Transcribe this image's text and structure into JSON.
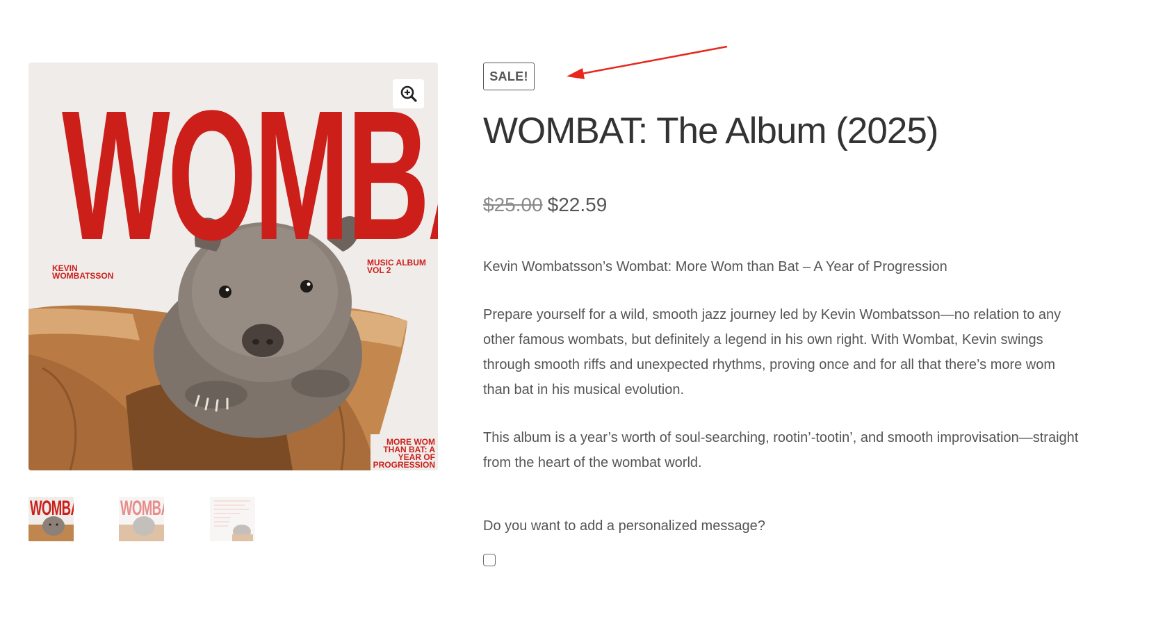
{
  "gallery": {
    "zoom_icon": "magnifier-plus-icon",
    "cover": {
      "title": "WOMBAT",
      "artist": "KEVIN WOMBATSSON",
      "volume": "MUSIC ALBUM VOL 2",
      "subtitle": "MORE WOM THAN BAT: A YEAR OF PROGRESSION"
    },
    "thumbnails": [
      {
        "title": "WOMBAT",
        "state": "active"
      },
      {
        "title": "WOMBAT",
        "state": "inactive"
      },
      {
        "title": "",
        "state": "inactive"
      }
    ]
  },
  "product": {
    "badge": "SALE!",
    "title": "WOMBAT: The Album (2025)",
    "price_regular": "$25.00",
    "price_sale": "$22.59",
    "description": {
      "intro": "Kevin Wombatsson’s Wombat: More Wom than Bat – A Year of Progression",
      "paragraph_1": "Prepare yourself for a wild, smooth jazz journey led by Kevin Wombatsson—no relation to any other famous wombats, but definitely a legend in his own right. With Wombat, Kevin swings through smooth riffs and unexpected rhythms, proving once and for all that there’s more wom than bat in his musical evolution.",
      "paragraph_2": "This album is a year’s worth of soul-searching, rootin’-tootin’, and smooth improvisation—straight from the heart of the wombat world."
    },
    "addon": {
      "label": "Do you want to add a personalized message?",
      "checked": false
    }
  },
  "colors": {
    "accent_red": "#cc1f1a",
    "annotation_arrow": "#e8261c",
    "text": "#555555",
    "title": "#333333"
  }
}
